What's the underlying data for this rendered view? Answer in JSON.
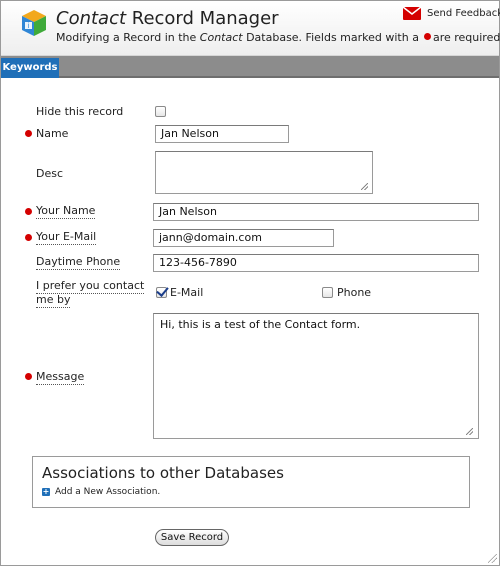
{
  "header": {
    "title_part1": "Contact",
    "title_part2": " Record Manager",
    "subtitle_pre": "Modifying a Record in the ",
    "subtitle_db": "Contact",
    "subtitle_post": " Database. Fields marked with a",
    "subtitle_end": "are required.",
    "feedback_label": "Send Feedback"
  },
  "tabs": [
    {
      "label": "Keywords",
      "active": true
    }
  ],
  "form": {
    "hide_label": "Hide this record",
    "name_label": "Name",
    "name_value": "Jan Nelson",
    "desc_label": "Desc",
    "desc_value": "",
    "your_name_label": "Your Name",
    "your_name_value": "Jan Nelson",
    "email_label": "Your E-Mail",
    "email_value": "jann@domain.com",
    "phone_label": "Daytime Phone",
    "phone_value": "123-456-7890",
    "contact_pref_label_line1": "I prefer you contact",
    "contact_pref_label_line2": "me by",
    "pref_email_label": "E-Mail",
    "pref_phone_label": "Phone",
    "message_label": "Message",
    "message_value": "Hi, this is a test of the Contact form."
  },
  "associations": {
    "title": "Associations to other Databases",
    "add_label": "Add a New Association."
  },
  "actions": {
    "save_label": "Save Record"
  },
  "colors": {
    "required": "#d40000",
    "accent": "#1f6fb8",
    "tabbar": "#8c8c8c"
  }
}
